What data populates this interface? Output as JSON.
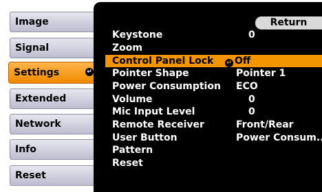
{
  "sidebar": {
    "items": [
      {
        "label": "Image"
      },
      {
        "label": "Signal"
      },
      {
        "label": "Settings",
        "active": true
      },
      {
        "label": "Extended"
      },
      {
        "label": "Network"
      },
      {
        "label": "Info"
      },
      {
        "label": "Reset"
      }
    ]
  },
  "panel": {
    "return_label": "Return",
    "rows": [
      {
        "name": "Keystone",
        "value": "0"
      },
      {
        "name": "Zoom",
        "value": ""
      },
      {
        "name": "Control Panel Lock",
        "value": "Off",
        "selected": true
      },
      {
        "name": "Pointer Shape",
        "value": "Pointer 1"
      },
      {
        "name": "Power Consumption",
        "value": "ECO"
      },
      {
        "name": "Volume",
        "value": "0"
      },
      {
        "name": "Mic Input Level",
        "value": "0"
      },
      {
        "name": "Remote Receiver",
        "value": "Front/Rear"
      },
      {
        "name": "User Button",
        "value": "Power Consum..."
      },
      {
        "name": "Pattern",
        "value": ""
      },
      {
        "name": "Reset",
        "value": ""
      }
    ]
  },
  "colors": {
    "accent": "#f39500",
    "panel_bg": "#000000",
    "sidebar_bg": "#c8c8d8"
  },
  "icons": {
    "enter": "enter-icon"
  }
}
